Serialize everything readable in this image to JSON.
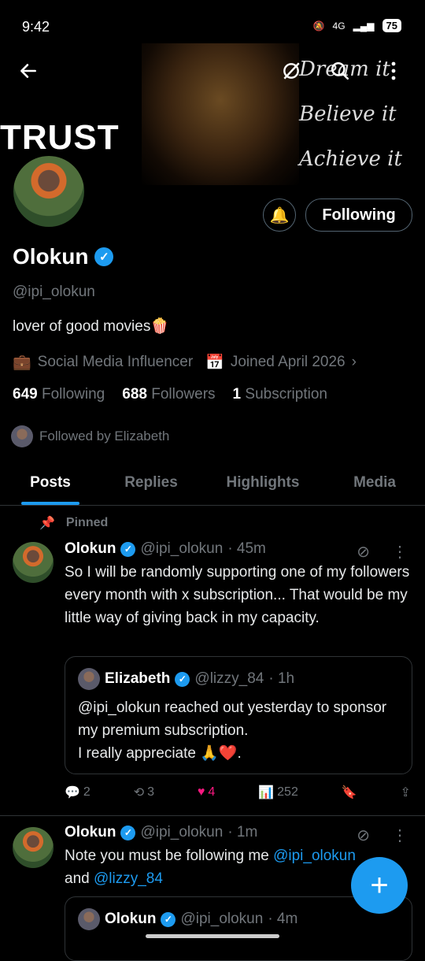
{
  "status": {
    "time": "9:42",
    "network": "4G",
    "battery": "75"
  },
  "banner": {
    "left_text": "TRUST",
    "lines": [
      "Dream it",
      "Believe it",
      "Achieve it"
    ]
  },
  "profile": {
    "name": "Olokun",
    "handle": "@ipi_olokun",
    "bio": "lover of good movies🍿",
    "category": "Social Media Influencer",
    "joined": "Joined April 2026",
    "following_count": "649",
    "following_label": "Following",
    "followers_count": "688",
    "followers_label": "Followers",
    "subscription_count": "1",
    "subscription_label": "Subscription",
    "followed_by": "Followed by Elizabeth",
    "follow_button": "Following"
  },
  "tabs": [
    "Posts",
    "Replies",
    "Highlights",
    "Media"
  ],
  "pinned_label": "Pinned",
  "post1": {
    "name": "Olokun",
    "handle": "@ipi_olokun",
    "time": "· 45m",
    "text": "So I will be randomly supporting one of my followers every month with x subscription... That would be my little way of giving back in my capacity.",
    "quote": {
      "name": "Elizabeth",
      "handle": "@lizzy_84",
      "time": "· 1h",
      "text_1": "@ipi_olokun reached out yesterday to sponsor my premium subscription.",
      "text_2": "I really appreciate 🙏❤️."
    },
    "replies": "2",
    "reposts": "3",
    "likes": "4",
    "views": "252"
  },
  "post2": {
    "name": "Olokun",
    "handle": "@ipi_olokun",
    "time": "· 1m",
    "text_prefix": "Note you must be following me ",
    "mention1": "@ipi_olokun",
    "text_mid": "and ",
    "mention2": "@lizzy_84",
    "quote": {
      "name": "Olokun",
      "handle": "@ipi_olokun",
      "time": "· 4m"
    }
  },
  "colors": {
    "accent": "#1d9bf0",
    "like": "#f91880",
    "muted": "#71767b"
  }
}
